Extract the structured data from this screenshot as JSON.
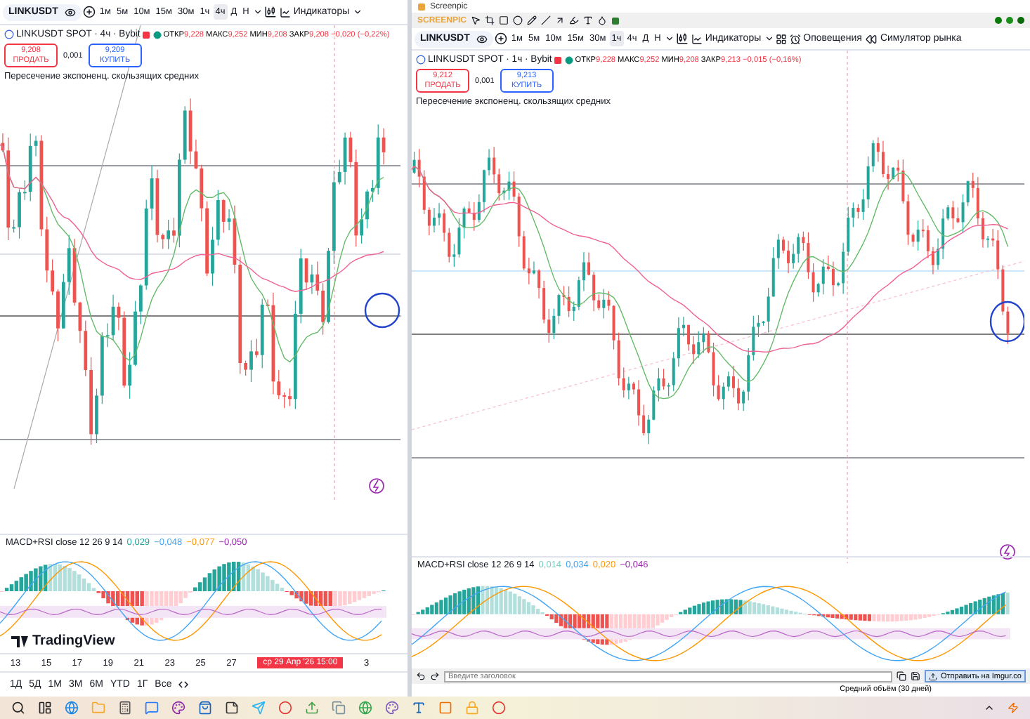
{
  "left_chart": {
    "toolbar": {
      "symbol": "LINKUSDT",
      "intervals": [
        {
          "label": "1м",
          "selected": false
        },
        {
          "label": "5м",
          "selected": false
        },
        {
          "label": "10м",
          "selected": false
        },
        {
          "label": "15м",
          "selected": false
        },
        {
          "label": "30м",
          "selected": false
        },
        {
          "label": "1ч",
          "selected": false
        },
        {
          "label": "4ч",
          "selected": true
        },
        {
          "label": "Д",
          "selected": false
        },
        {
          "label": "Н",
          "selected": false
        }
      ],
      "indicators_label": "Индикаторы"
    },
    "legend": {
      "title": "LINKUSDT SPOT · 4ч · Bybit",
      "ohlc": [
        {
          "label": "ОТКР",
          "value": "9,228"
        },
        {
          "label": "МАКС",
          "value": "9,252"
        },
        {
          "label": "МИН",
          "value": "9,208"
        },
        {
          "label": "ЗАКР",
          "value": "9,208"
        }
      ],
      "change": "−0,020 (−0,22%)"
    },
    "sell": {
      "price": "9,208",
      "label": "ПРОДАТЬ"
    },
    "spread": "0,001",
    "buy": {
      "price": "9,209",
      "label": "КУПИТЬ"
    },
    "indicator": "Пересечение экспоненц. скользящих средних",
    "macd": {
      "title": "MACD+RSI close 12 26 9 14",
      "values": [
        {
          "text": "0,029",
          "color": "#26a69a"
        },
        {
          "text": "−0,048",
          "color": "#42a5f5"
        },
        {
          "text": "−0,077",
          "color": "#ff9800"
        },
        {
          "text": "−0,050",
          "color": "#9c27b0"
        }
      ]
    },
    "logo_text": "TradingView",
    "time_axis": [
      "13",
      "15",
      "17",
      "19",
      "21",
      "23",
      "25",
      "27"
    ],
    "crosshair_label": "ср 29 Апр '26   15:00",
    "time_axis_end": "3",
    "ranges": [
      "1Д",
      "5Д",
      "1М",
      "3М",
      "6М",
      "YTD",
      "1Г",
      "Все"
    ]
  },
  "screenpic": {
    "title": "Screenpic",
    "brand": "SCREENPIC",
    "caption_placeholder": "Введите заголовок",
    "send_label": "Отправить на Imgur.co"
  },
  "right_chart": {
    "toolbar": {
      "symbol": "LINKUSDT",
      "intervals": [
        {
          "label": "1м",
          "selected": false
        },
        {
          "label": "5м",
          "selected": false
        },
        {
          "label": "10м",
          "selected": false
        },
        {
          "label": "15м",
          "selected": false
        },
        {
          "label": "30м",
          "selected": false
        },
        {
          "label": "1ч",
          "selected": true
        },
        {
          "label": "4ч",
          "selected": false
        },
        {
          "label": "Д",
          "selected": false
        },
        {
          "label": "Н",
          "selected": false
        }
      ],
      "indicators_label": "Индикаторы",
      "alerts_label": "Оповещения",
      "simulator_label": "Симулятор рынка"
    },
    "legend": {
      "title": "LINKUSDT SPOT · 1ч · Bybit",
      "ohlc": [
        {
          "label": "ОТКР",
          "value": "9,228"
        },
        {
          "label": "МАКС",
          "value": "9,252"
        },
        {
          "label": "МИН",
          "value": "9,208"
        },
        {
          "label": "ЗАКР",
          "value": "9,213"
        }
      ],
      "change": "−0,015 (−0,16%)"
    },
    "sell": {
      "price": "9,212",
      "label": "ПРОДАТЬ"
    },
    "spread": "0,001",
    "buy": {
      "price": "9,213",
      "label": "КУПИТЬ"
    },
    "indicator": "Пересечение экспоненц. скользящих средних",
    "macd": {
      "title": "MACD+RSI close 12 26 9 14",
      "values": [
        {
          "text": "0,014",
          "color": "#80cbc4"
        },
        {
          "text": "0,034",
          "color": "#42a5f5"
        },
        {
          "text": "0,020",
          "color": "#ff9800"
        },
        {
          "text": "−0,046",
          "color": "#9c27b0"
        }
      ]
    },
    "volume_label": "Средний объём (30 дней)"
  }
}
